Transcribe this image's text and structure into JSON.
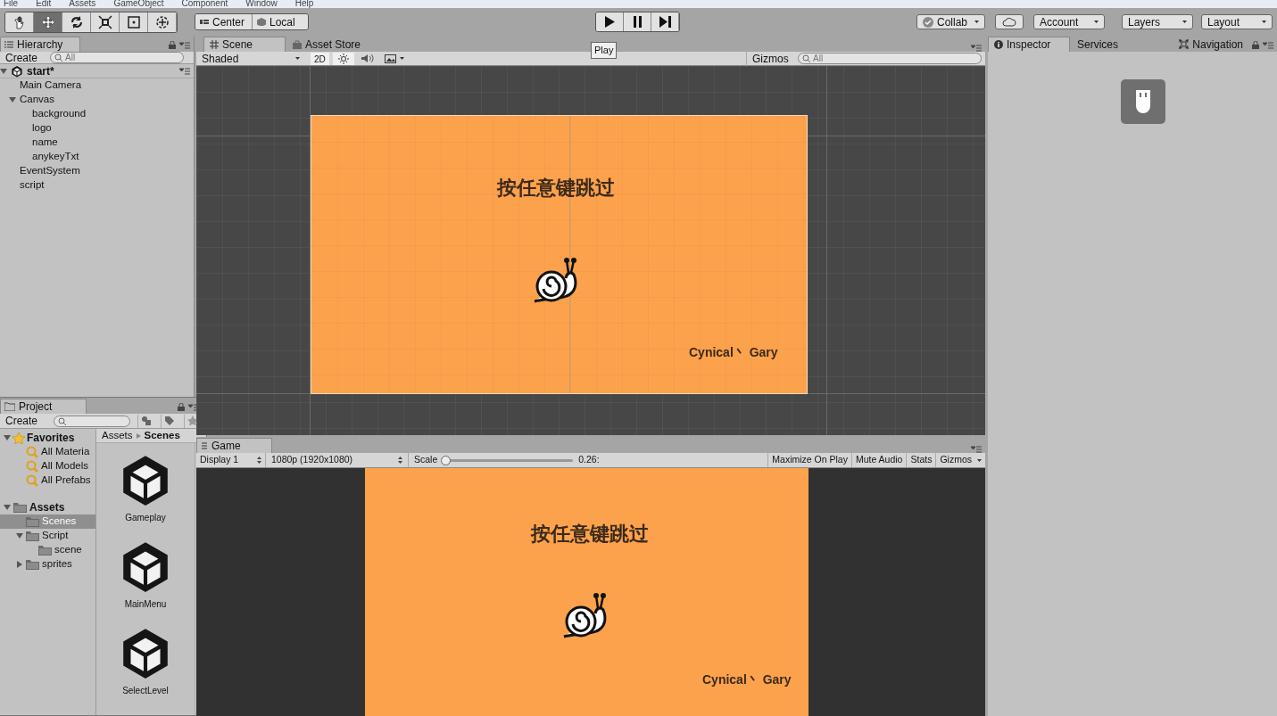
{
  "menu_bar": [
    "File",
    "Edit",
    "Assets",
    "GameObject",
    "Component",
    "Window",
    "Help"
  ],
  "toolbar": {
    "tools": [
      {
        "kind": "hand",
        "selected": false
      },
      {
        "kind": "move",
        "selected": true
      },
      {
        "kind": "rotate",
        "selected": false
      },
      {
        "kind": "scale",
        "selected": false
      },
      {
        "kind": "rect",
        "selected": false
      },
      {
        "kind": "transform",
        "selected": false
      }
    ],
    "pivot": [
      "Center",
      "Local"
    ],
    "play_controls": [
      {
        "kind": "play"
      },
      {
        "kind": "pause"
      },
      {
        "kind": "step"
      }
    ],
    "tooltip": "Play",
    "collab": "Collab",
    "account": "Account",
    "layers": "Layers",
    "layout": "Layout"
  },
  "hierarchy": {
    "tab": "Hierarchy",
    "create": "Create",
    "search_placeholder": "All",
    "scene": "start*",
    "items": [
      {
        "label": "Main Camera"
      },
      {
        "label": "Canvas",
        "expanded": true,
        "children": [
          {
            "label": "background"
          },
          {
            "label": "logo"
          },
          {
            "label": "name"
          },
          {
            "label": "anykeyTxt"
          }
        ]
      },
      {
        "label": "EventSystem"
      },
      {
        "label": "script"
      }
    ]
  },
  "scene_panel": {
    "tabs": [
      {
        "label": "Scene",
        "selected": true
      },
      {
        "label": "Asset Store",
        "selected": false
      }
    ],
    "shading": "Shaded",
    "mode_2d": "2D",
    "lighting": {
      "on": true
    },
    "audio": {
      "on": false
    },
    "gizmos": "Gizmos",
    "search_placeholder": "All",
    "title": "按任意键跳过",
    "credit": "Cynical丶 Gary"
  },
  "inspector": {
    "tabs": [
      {
        "label": "Inspector",
        "selected": true
      },
      {
        "label": "Services",
        "selected": false
      }
    ],
    "navigation": "Navigation"
  },
  "project": {
    "tab": "Project",
    "create": "Create",
    "favorites_label": "Favorites",
    "favorites": [
      "All Materia",
      "All Models",
      "All Prefabs"
    ],
    "assets": {
      "label": "Assets",
      "expanded": true,
      "selected": false,
      "children": [
        {
          "label": "Scenes",
          "selected": true
        },
        {
          "label": "Script",
          "expanded": true,
          "selected": false,
          "children": [
            {
              "label": "scene",
              "selected": false
            }
          ]
        },
        {
          "label": "sprites",
          "expanded": false,
          "selected": false
        }
      ]
    },
    "breadcrumb": [
      "Assets",
      "Scenes"
    ],
    "files": [
      "Gameplay",
      "MainMenu",
      "SelectLevel"
    ]
  },
  "game_panel": {
    "tab": "Game",
    "display": "Display 1",
    "resolution": "1080p (1920x1080)",
    "scale_label": "Scale",
    "scale": {
      "level": 0.02
    },
    "scale_value": "0.26:",
    "buttons": [
      "Maximize On Play",
      "Mute Audio",
      "Stats",
      "Gizmos"
    ],
    "title": "按任意键跳过",
    "credit": "Cynical丶 Gary"
  }
}
